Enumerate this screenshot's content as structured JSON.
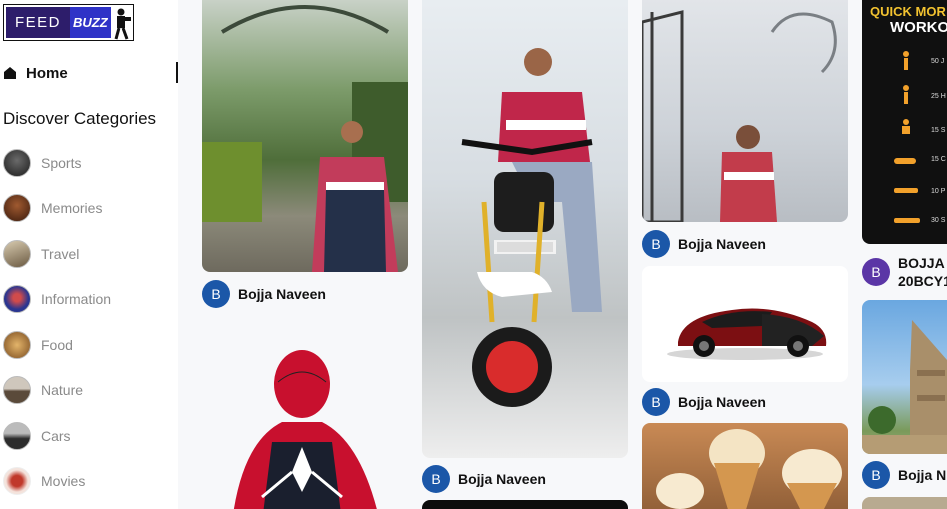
{
  "logo": {
    "left": "FEED",
    "right": "BUZZ"
  },
  "nav": {
    "home": "Home"
  },
  "discover": {
    "title": "Discover Categories"
  },
  "categories": [
    {
      "label": "Sports",
      "color": "#3a3a3a"
    },
    {
      "label": "Memories",
      "color": "#6b3a1f"
    },
    {
      "label": "Travel",
      "color": "#8c7a5c"
    },
    {
      "label": "Information",
      "color": "#3a3f9e"
    },
    {
      "label": "Food",
      "color": "#b07a3c"
    },
    {
      "label": "Nature",
      "color": "#6a5e4e"
    },
    {
      "label": "Cars",
      "color": "#4a4a4a"
    },
    {
      "label": "Movies",
      "color": "#c0392b"
    }
  ],
  "feed": {
    "posts": [
      {
        "author": "Bojja Naveen",
        "avatar": "B"
      },
      {
        "author": "Bojja Naveen",
        "avatar": "B"
      },
      {
        "author": "Bojja Naveen",
        "avatar": "B"
      },
      {
        "author": "Bojja Naveen",
        "avatar": "B"
      },
      {
        "author": "BOJJA",
        "author_line2": "20BCY1",
        "avatar": "B"
      },
      {
        "author": "Bojja N",
        "avatar": "B"
      }
    ],
    "workout": {
      "title1": "QUICK MOR",
      "title2": "WORKO",
      "items": [
        "50 J",
        "25 H",
        "15 S",
        "15 C",
        "10 P",
        "30 S"
      ]
    }
  }
}
